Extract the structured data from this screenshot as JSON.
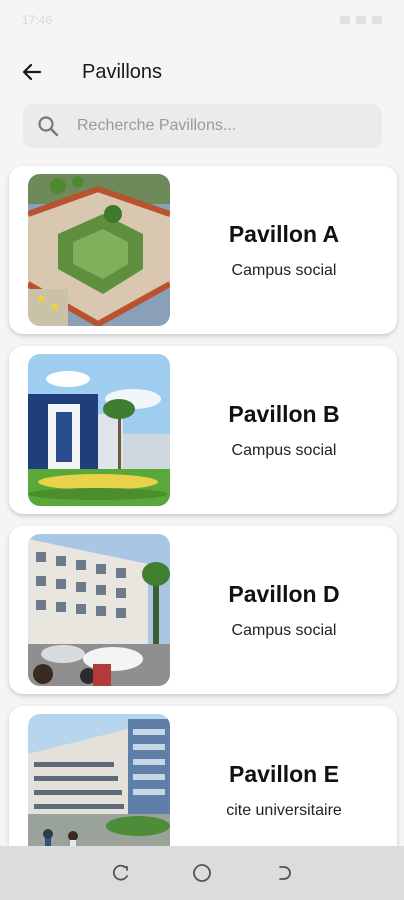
{
  "status_bar": {
    "time": "17:46",
    "right_text": ""
  },
  "header": {
    "title": "Pavillons",
    "back_icon": "arrow-left-icon"
  },
  "search": {
    "placeholder": "Recherche Pavillons...",
    "value": "",
    "icon": "search-icon"
  },
  "pavillons": [
    {
      "name": "Pavillon A",
      "location": "Campus social"
    },
    {
      "name": "Pavillon B",
      "location": "Campus social"
    },
    {
      "name": "Pavillon D",
      "location": "Campus social"
    },
    {
      "name": "Pavillon E",
      "location": "cite universitaire"
    }
  ],
  "nav": {
    "recents_icon": "recents-icon",
    "home_icon": "home-circle-icon",
    "back_icon": "back-nav-icon"
  },
  "colors": {
    "background": "#f5f5f5",
    "card": "#ffffff",
    "search_bg": "#ebebeb",
    "nav_bg": "#dcdcdc"
  }
}
